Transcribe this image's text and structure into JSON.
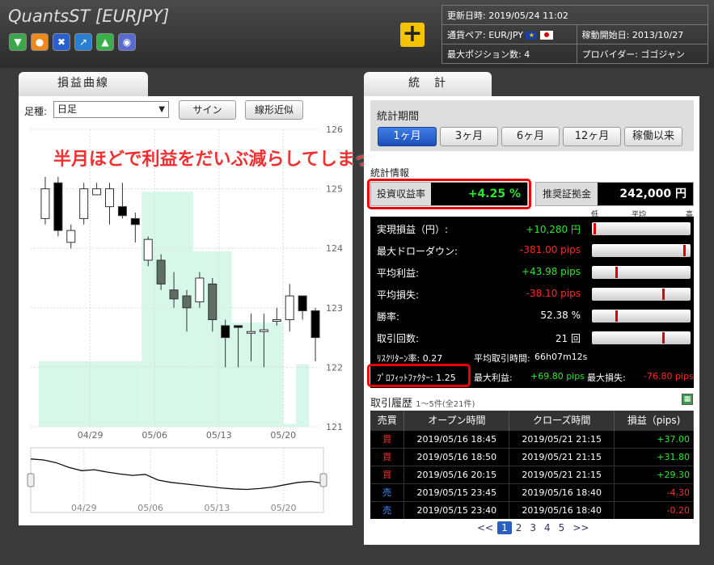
{
  "header": {
    "title": "QuantsST [EURJPY]",
    "info": {
      "updated_label": "更新日時:",
      "updated_value": "2019/05/24 11:02",
      "pair_label": "通貨ペア:",
      "pair_value": "EUR/JPY",
      "start_label": "稼動開始日:",
      "start_value": "2013/10/27",
      "maxpos_label": "最大ポジション数:",
      "maxpos_value": "4",
      "provider_label": "プロバイダー:",
      "provider_value": "ゴゴジャン"
    }
  },
  "left": {
    "tab": "損益曲線",
    "ashi_label": "足種:",
    "ashi_value": "日足",
    "sign_btn": "サイン",
    "linear_btn": "線形近似"
  },
  "annotation": "半月ほどで利益をだいぶ減らしてしまった",
  "right": {
    "tab": "統　計",
    "period_label": "統計期間",
    "periods": [
      "1ヶ月",
      "3ヶ月",
      "6ヶ月",
      "12ヶ月",
      "稼働以来"
    ],
    "stats_label": "統計情報",
    "return_label": "投資収益率",
    "return_value": "+4.25 %",
    "margin_label": "推奨証拠金",
    "margin_value": "242,000 円",
    "scale": {
      "low": "低",
      "mid": "平均",
      "high": "高"
    },
    "rows": [
      {
        "label": "実現損益（円）:",
        "value": "+10,280 円",
        "color": "g",
        "marker": 0.02
      },
      {
        "label": "最大ドローダウン:",
        "value": "-381.00 pips",
        "color": "r",
        "marker": 0.97
      },
      {
        "label": "平均利益:",
        "value": "+43.98 pips",
        "color": "g",
        "marker": 0.25
      },
      {
        "label": "平均損失:",
        "value": "-38.10 pips",
        "color": "r",
        "marker": 0.75
      },
      {
        "label": "勝率:",
        "value": "52.38 %",
        "color": "w",
        "marker": 0.25
      },
      {
        "label": "取引回数:",
        "value": "21 回",
        "color": "w",
        "marker": 0.75
      }
    ],
    "risk_return_label": "ﾘｽｸﾘﾀｰﾝ率: 0.27",
    "avg_time_label": "平均取引時間:",
    "avg_time_value": "66h07m12s",
    "pf_label": "ﾌﾟﾛﾌｨｯﾄﾌｧｸﾀｰ: 1.25",
    "max_profit_label": "最大利益:",
    "max_profit_value": "+69.80 pips",
    "max_loss_label": "最大損失:",
    "max_loss_value": "-76.80 pips",
    "history_title": "取引履歴",
    "history_count": "1〜5件(全21件)",
    "history_headers": [
      "売買",
      "オープン時間",
      "クローズ時間",
      "損益（pips)"
    ],
    "history": [
      {
        "side": "買",
        "side_color": "#ff3030",
        "open": "2019/05/16 18:45",
        "close": "2019/05/21 21:15",
        "pnl": "+37.00",
        "pnl_color": "#2ee62e"
      },
      {
        "side": "買",
        "side_color": "#ff3030",
        "open": "2019/05/16 18:50",
        "close": "2019/05/21 21:15",
        "pnl": "+31.80",
        "pnl_color": "#2ee62e"
      },
      {
        "side": "買",
        "side_color": "#ff3030",
        "open": "2019/05/16 20:15",
        "close": "2019/05/21 21:15",
        "pnl": "+29.30",
        "pnl_color": "#2ee62e"
      },
      {
        "side": "売",
        "side_color": "#4a8cff",
        "open": "2019/05/15 23:45",
        "close": "2019/05/16 18:40",
        "pnl": "-4.30",
        "pnl_color": "#ff3030"
      },
      {
        "side": "売",
        "side_color": "#4a8cff",
        "open": "2019/05/15 23:40",
        "close": "2019/05/16 18:40",
        "pnl": "-0.20",
        "pnl_color": "#ff3030"
      }
    ],
    "pagination": [
      "<<",
      "1",
      "2",
      "3",
      "4",
      "5",
      ">>"
    ],
    "current_page": "1"
  },
  "chart_data": {
    "type": "candlestick",
    "ylim": [
      121,
      126
    ],
    "yticks": [
      "121",
      "122",
      "123",
      "124",
      "125",
      "126"
    ],
    "xticks": [
      "04/29",
      "05/06",
      "05/13",
      "05/20"
    ],
    "candles": [
      {
        "o": 124.5,
        "c": 125.0,
        "h": 125.2,
        "l": 124.4
      },
      {
        "o": 125.1,
        "c": 124.3,
        "h": 125.2,
        "l": 124.2
      },
      {
        "o": 124.1,
        "c": 124.3,
        "h": 124.4,
        "l": 124.0
      },
      {
        "o": 124.5,
        "c": 125.0,
        "h": 125.1,
        "l": 124.4
      },
      {
        "o": 124.9,
        "c": 125.0,
        "h": 125.1,
        "l": 124.9
      },
      {
        "o": 124.7,
        "c": 125.0,
        "h": 125.1,
        "l": 124.4
      },
      {
        "o": 124.7,
        "c": 124.55,
        "h": 125.1,
        "l": 124.5
      },
      {
        "o": 124.5,
        "c": 124.4,
        "h": 124.6,
        "l": 124.1
      },
      {
        "o": 123.8,
        "c": 124.15,
        "h": 124.2,
        "l": 123.7
      },
      {
        "o": 123.8,
        "c": 123.4,
        "h": 123.9,
        "l": 123.3
      },
      {
        "o": 123.3,
        "c": 123.15,
        "h": 123.6,
        "l": 123.0
      },
      {
        "o": 123.2,
        "c": 123.0,
        "h": 123.3,
        "l": 122.6
      },
      {
        "o": 123.1,
        "c": 123.5,
        "h": 123.6,
        "l": 123.0
      },
      {
        "o": 123.4,
        "c": 122.8,
        "h": 123.5,
        "l": 122.6
      },
      {
        "o": 122.7,
        "c": 122.5,
        "h": 122.8,
        "l": 122.0
      },
      {
        "o": 122.7,
        "c": 122.67,
        "h": 122.7,
        "l": 122.0
      },
      {
        "o": 122.6,
        "c": 122.6,
        "h": 122.9,
        "l": 122.1
      },
      {
        "o": 122.6,
        "c": 122.63,
        "h": 122.9,
        "l": 122.0
      },
      {
        "o": 122.8,
        "c": 122.8,
        "h": 123.0,
        "l": 122.7
      },
      {
        "o": 122.8,
        "c": 123.2,
        "h": 123.4,
        "l": 122.6
      },
      {
        "o": 123.2,
        "c": 122.95,
        "h": 123.2,
        "l": 122.8
      },
      {
        "o": 122.95,
        "c": 122.5,
        "h": 123.0,
        "l": 122.1
      }
    ],
    "shade": [
      {
        "from": 0,
        "to": 7,
        "level": 122.1
      },
      {
        "from": 8,
        "to": 11,
        "level": 124.95
      },
      {
        "from": 12,
        "to": 14,
        "level": 123.95
      },
      {
        "from": 15,
        "to": 18,
        "level": 122.75
      },
      {
        "from": 19,
        "to": 19,
        "level": 121.05
      },
      {
        "from": 20,
        "to": 20,
        "level": 122.05
      }
    ],
    "overview": [
      0.1,
      0.12,
      0.18,
      0.28,
      0.35,
      0.33,
      0.38,
      0.42,
      0.45,
      0.43,
      0.55,
      0.6,
      0.63,
      0.66,
      0.69,
      0.72,
      0.74,
      0.75,
      0.73,
      0.7,
      0.65,
      0.6,
      0.58,
      0.62
    ]
  }
}
